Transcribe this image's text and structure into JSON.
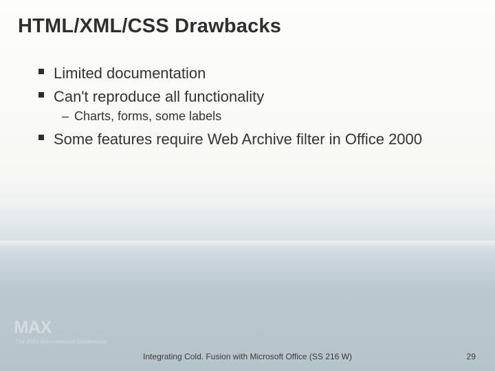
{
  "title": "HTML/XML/CSS Drawbacks",
  "bullets": [
    {
      "text": "Limited documentation",
      "sub": []
    },
    {
      "text": "Can't reproduce all functionality",
      "sub": [
        "Charts, forms, some labels"
      ]
    },
    {
      "text": "Some features require Web Archive filter in Office 2000",
      "sub": []
    }
  ],
  "logo": {
    "text": "MAX",
    "tagline": "The 2003 Macromedia® Conference"
  },
  "footer": "Integrating Cold. Fusion with Microsoft Office (SS 216 W)",
  "page_number": "29"
}
